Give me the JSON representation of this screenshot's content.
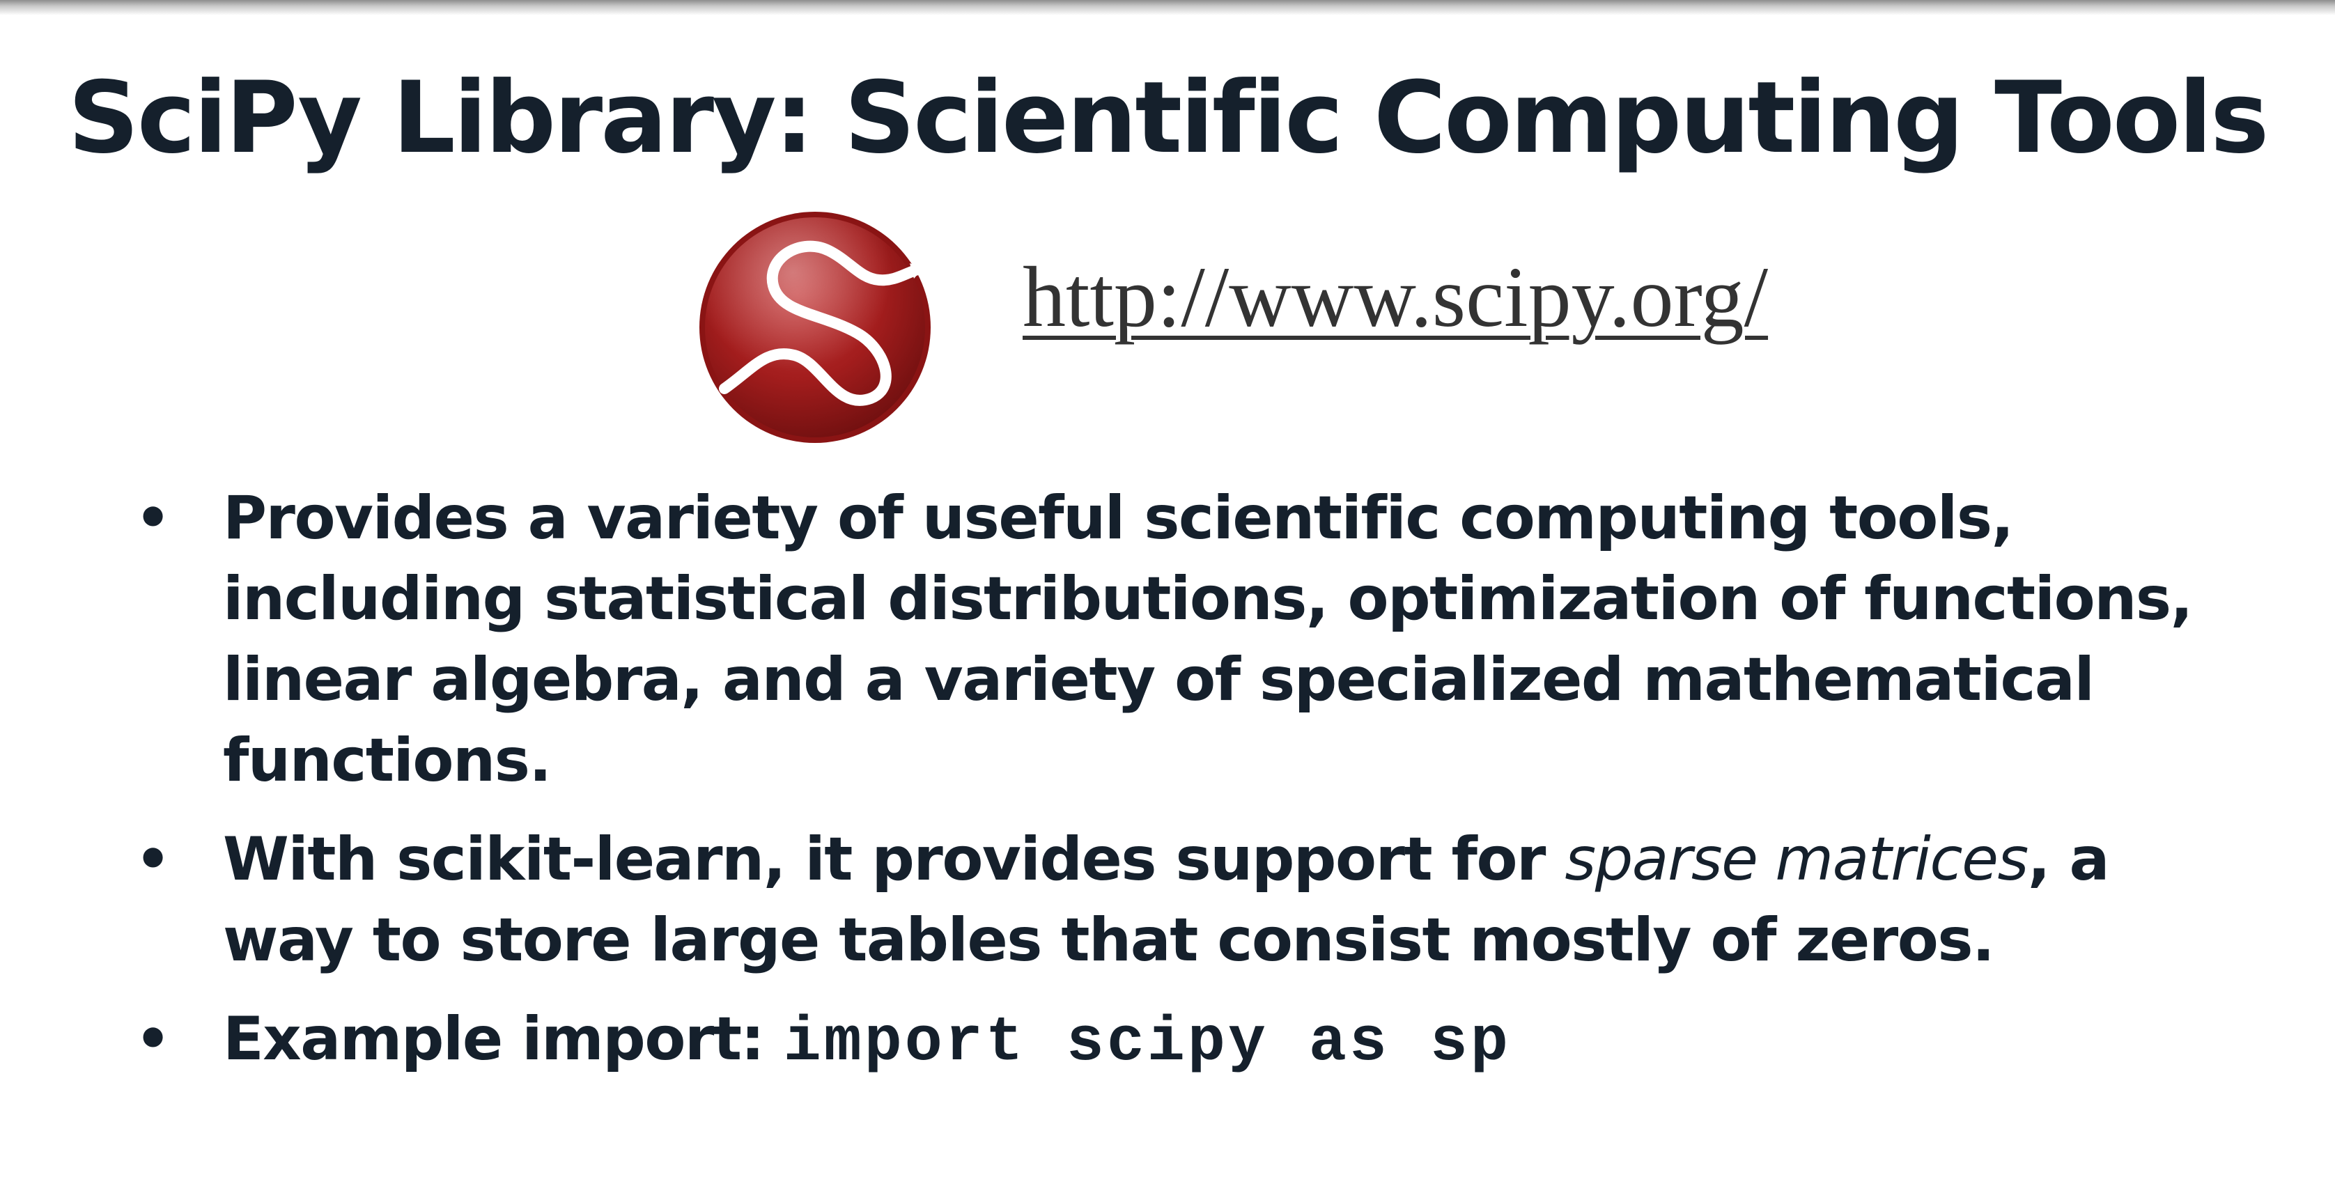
{
  "slide": {
    "title": "SciPy Library: Scientific Computing Tools",
    "logo_icon": "scipy-logo-icon",
    "url": "http://www.scipy.org/",
    "colors": {
      "title_text": "#15202c",
      "logo_red": "#a31d1d",
      "url_text": "#333333"
    }
  },
  "bullets": [
    {
      "lines": [
        "Provides a variety of useful scientific computing tools,",
        "including statistical distributions, optimization of functions,",
        "linear algebra, and a variety of specialized mathematical",
        "functions."
      ]
    },
    {
      "line1_before": "With scikit-learn, it provides support for ",
      "line1_emphasis": "sparse matrices",
      "line1_after": ", a",
      "line2": "way to store large tables that consist mostly of zeros."
    },
    {
      "prefix": "Example import: ",
      "code": "import scipy as sp"
    }
  ]
}
